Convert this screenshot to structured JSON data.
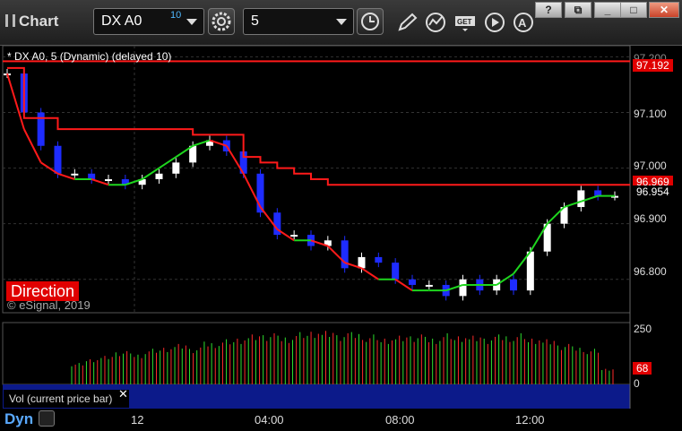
{
  "app": {
    "title": "Chart"
  },
  "toolbar": {
    "symbol": "DX A0",
    "symbol_delay": "10",
    "interval": "5",
    "icons": [
      "settings-gear-icon",
      "clock-icon",
      "pencil-draw-icon",
      "study-icon",
      "get-data-icon",
      "play-icon",
      "alert-icon"
    ],
    "window_buttons": [
      "?",
      "⧉",
      "_",
      "□",
      "✕"
    ]
  },
  "chart": {
    "header": "* DX A0, 5 (Dynamic) (delayed 10)",
    "direction_label": "Direction",
    "watermark": "© eSignal, 2019",
    "price_axis": [
      "97.200",
      "97.100",
      "97.000",
      "96.900",
      "96.800"
    ],
    "price_tags": [
      {
        "value": "97.192",
        "bg": "#e00000",
        "fg": "#ffffff"
      },
      {
        "value": "96.969",
        "bg": "#e00000",
        "fg": "#ffffff"
      },
      {
        "value": "96.954",
        "bg": "#000000",
        "fg": "#ffffff"
      }
    ],
    "volume_axis": [
      "250",
      "0"
    ],
    "volume_tag": {
      "value": "68",
      "bg": "#e00000"
    },
    "volume_label": "Vol (current price bar)",
    "time_axis": [
      "12",
      "04:00",
      "08:00",
      "12:00"
    ],
    "workspace_label": "Dyn",
    "colors": {
      "up": "#ffffff",
      "down": "#1e2cff",
      "red_line": "#ff1a1a",
      "green_line": "#1ed61e",
      "vol_up": "#2ee02e",
      "vol_down": "#ff2a2a",
      "pane_bg": "#000000",
      "footer_bg": "#0c1a8a"
    }
  },
  "chart_data": {
    "type": "line",
    "title": "",
    "series": [
      {
        "name": "",
        "type": "close",
        "values": [
          97.17,
          97.1,
          97.04,
          96.99,
          96.99,
          96.98,
          96.98,
          96.97,
          96.98,
          96.99,
          97.01,
          97.04,
          97.05,
          97.03,
          96.99,
          96.92,
          96.88,
          96.88,
          96.86,
          96.87,
          96.82,
          96.84,
          96.83,
          96.8,
          96.79,
          96.79,
          96.77,
          96.8,
          96.78,
          96.8,
          96.78,
          96.85,
          96.9,
          96.93,
          96.96,
          96.95,
          96.95
        ]
      },
      {
        "name": "",
        "type": "stepped-line",
        "values": [
          97.18,
          97.09,
          97.09,
          97.07,
          97.07,
          97.07,
          97.07,
          97.07,
          97.07,
          97.07,
          97.07,
          97.06,
          97.06,
          97.06,
          97.02,
          97.01,
          97.0,
          96.99,
          96.98,
          96.97,
          96.97,
          96.97,
          96.97,
          96.97,
          96.97,
          96.97,
          96.97,
          96.97,
          96.97,
          96.97,
          96.97,
          96.97,
          96.97,
          96.97,
          96.97,
          96.97,
          96.97
        ]
      },
      {
        "name": "",
        "type": "moving-average",
        "values": [
          97.17,
          97.07,
          97.01,
          96.99,
          96.98,
          96.98,
          96.97,
          96.97,
          96.98,
          97.0,
          97.02,
          97.04,
          97.05,
          97.04,
          96.99,
          96.93,
          96.89,
          96.87,
          96.87,
          96.86,
          96.83,
          96.82,
          96.8,
          96.8,
          96.78,
          96.78,
          96.78,
          96.79,
          96.79,
          96.79,
          96.81,
          96.85,
          96.9,
          96.93,
          96.94,
          96.95,
          96.95
        ]
      }
    ],
    "volume": [
      90,
      110,
      120,
      140,
      130,
      150,
      160,
      170,
      155,
      180,
      190,
      200,
      210,
      215,
      205,
      220,
      230,
      225,
      215,
      220,
      210,
      200,
      205,
      210,
      200,
      215,
      210,
      205,
      200,
      210,
      215,
      200,
      190,
      170,
      160,
      150,
      68
    ],
    "ylim": [
      96.74,
      97.22
    ],
    "volume_ylim": [
      0,
      260
    ],
    "grid": true
  }
}
